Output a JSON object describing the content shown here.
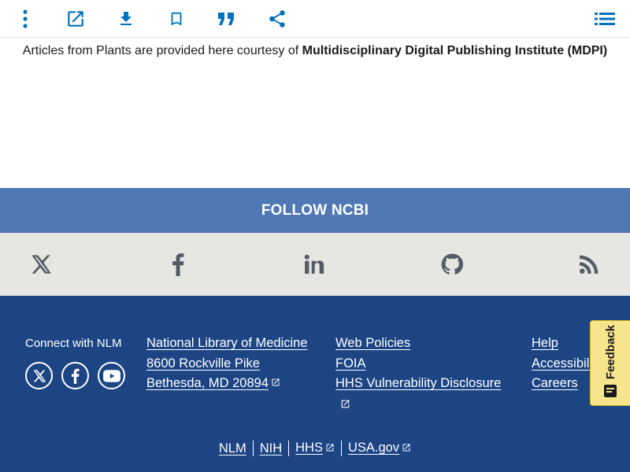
{
  "toolbar": {
    "icons": [
      "more-vertical-icon",
      "open-external-icon",
      "download-icon",
      "bookmark-icon",
      "quote-icon",
      "share-icon",
      "list-icon"
    ],
    "accent": "#0071bc"
  },
  "courtesy": {
    "prefix": "Articles from Plants are provided here courtesy of ",
    "publisher": "Multidisciplinary Digital Publishing Institute (MDPI)"
  },
  "follow": {
    "title": "FOLLOW NCBI",
    "bg": "#4f78b4",
    "icons": [
      "x-twitter-icon",
      "facebook-icon",
      "linkedin-icon",
      "github-icon",
      "rss-icon"
    ]
  },
  "footer": {
    "connect_label": "Connect with NLM",
    "connect_icons": [
      "x-twitter-icon",
      "facebook-icon",
      "youtube-icon"
    ],
    "address": {
      "name": "National Library of Medicine",
      "street": "8600 Rockville Pike",
      "city": "Bethesda, MD 20894"
    },
    "policies": {
      "web_policies": "Web Policies",
      "foia": "FOIA",
      "hhs_vuln": "HHS Vulnerability Disclosure"
    },
    "help": {
      "help": "Help",
      "accessibility": "Accessibility",
      "careers": "Careers"
    },
    "bottom": [
      "NLM",
      "NIH",
      "HHS",
      "USA.gov"
    ],
    "bg": "#1d4584"
  },
  "feedback": {
    "label": "Feedback",
    "bg": "#f7e58e"
  }
}
